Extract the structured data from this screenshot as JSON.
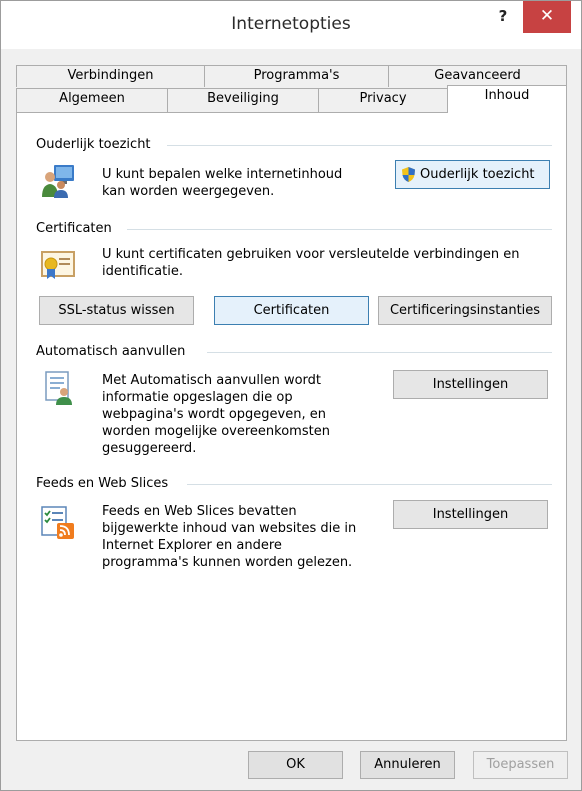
{
  "window": {
    "title": "Internetopties",
    "help": "?",
    "close": "✕"
  },
  "tabs_back": [
    {
      "label": "Verbindingen"
    },
    {
      "label": "Programma's"
    },
    {
      "label": "Geavanceerd"
    }
  ],
  "tabs_front": [
    {
      "label": "Algemeen"
    },
    {
      "label": "Beveiliging"
    },
    {
      "label": "Privacy"
    },
    {
      "label": "Inhoud"
    }
  ],
  "parental": {
    "title": "Ouderlijk toezicht",
    "desc_line1": "U kunt bepalen welke internetinhoud",
    "desc_line2": "kan worden weergegeven.",
    "button": "Ouderlijk toezicht"
  },
  "certificates": {
    "title": "Certificaten",
    "desc_line1": "U kunt certificaten gebruiken voor versleutelde verbindingen en",
    "desc_line2": "identificatie.",
    "ssl_button": "SSL-status wissen",
    "cert_button": "Certificaten",
    "publishers_button": "Certificeringsinstanties"
  },
  "autocomplete": {
    "title": "Automatisch aanvullen",
    "desc_lines": [
      "Met Automatisch aanvullen wordt",
      "informatie opgeslagen die op",
      "webpagina's wordt opgegeven, en",
      "worden mogelijke overeenkomsten",
      "gesuggereerd."
    ],
    "button": "Instellingen"
  },
  "feeds": {
    "title": "Feeds en Web Slices",
    "desc_lines": [
      "Feeds en Web Slices bevatten",
      "bijgewerkte inhoud van websites die in",
      "Internet Explorer en andere",
      "programma's kunnen worden gelezen."
    ],
    "button": "Instellingen"
  },
  "footer": {
    "ok": "OK",
    "cancel": "Annuleren",
    "apply": "Toepassen"
  }
}
